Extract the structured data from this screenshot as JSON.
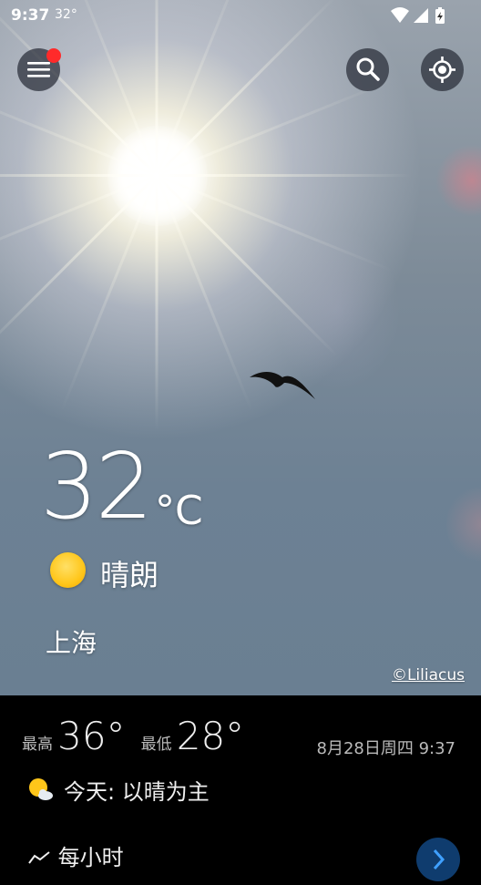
{
  "status_bar": {
    "time": "9:37",
    "temperature": "32°"
  },
  "header": {
    "menu_icon": "hamburger-menu-icon",
    "search_icon": "search-icon",
    "location_icon": "my-location-icon",
    "notification_dot_color": "#ff2a2a"
  },
  "current": {
    "temperature": "32",
    "unit": "°C",
    "condition": "晴朗",
    "condition_icon": "sun-icon",
    "city": "上海"
  },
  "photo_credit": "©Liliacus",
  "summary": {
    "high_label": "最高",
    "high_value": "36°",
    "low_label": "最低",
    "low_value": "28°",
    "datetime": "8月28日周四 9:37",
    "today_text": "今天: 以晴为主",
    "today_icon": "partly-sunny-icon"
  },
  "hourly": {
    "label": "每小时",
    "icon": "hourly-chart-icon"
  },
  "colors": {
    "panel_bg": "#000000",
    "next_button": "#0f3c6e",
    "sun_yellow": "#ffc61a"
  }
}
